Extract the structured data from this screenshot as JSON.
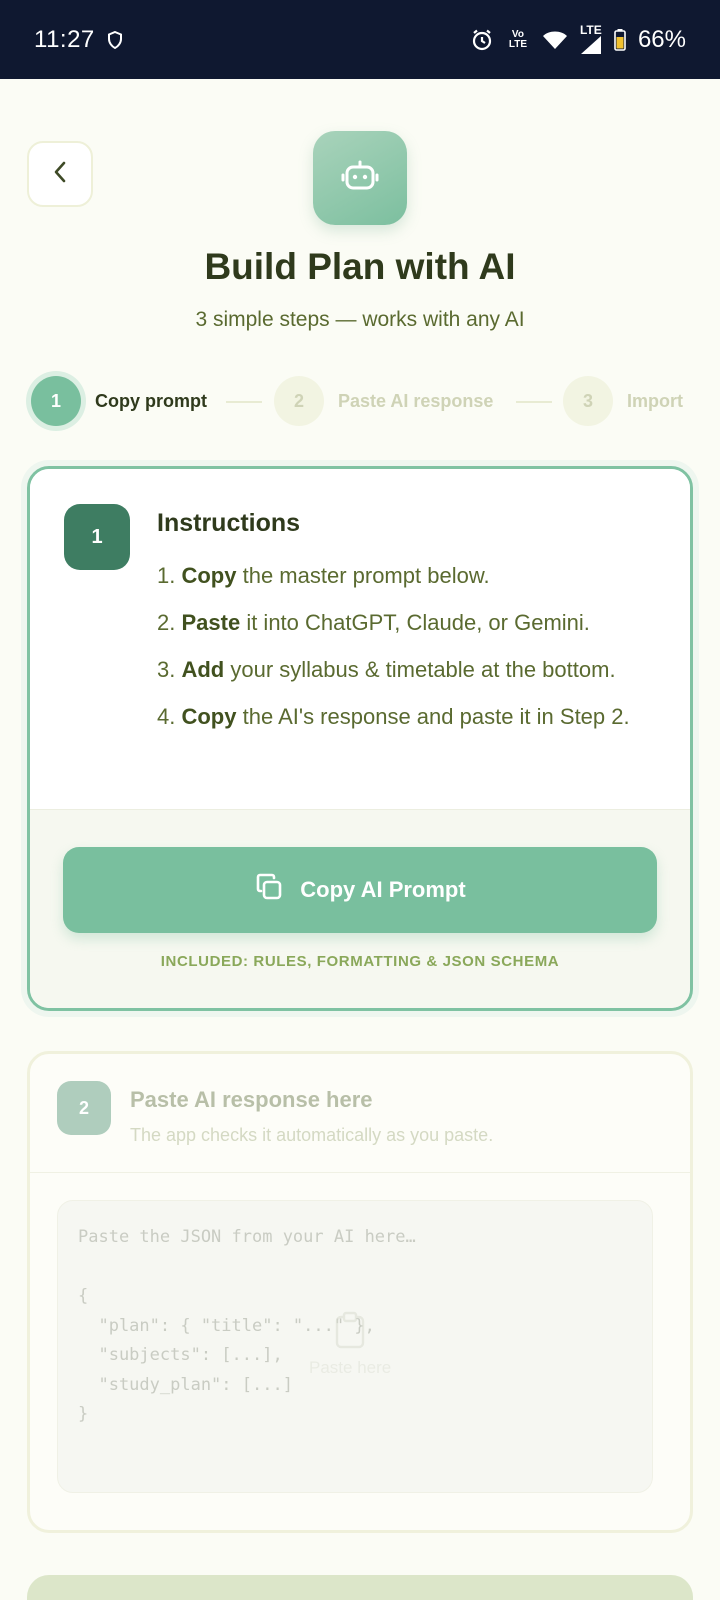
{
  "status_bar": {
    "time": "11:27",
    "volte_label": "Vo LTE",
    "lte_label": "LTE",
    "battery": "66%"
  },
  "header": {
    "title": "Build Plan with AI",
    "subtitle": "3 simple steps — works with any AI"
  },
  "stepper": {
    "steps": [
      {
        "number": "1",
        "label": "Copy prompt"
      },
      {
        "number": "2",
        "label": "Paste AI response"
      },
      {
        "number": "3",
        "label": "Import"
      }
    ]
  },
  "card_instructions": {
    "number": "1",
    "title": "Instructions",
    "items": [
      {
        "num": "1.",
        "bold": "Copy",
        "rest": " the master prompt below."
      },
      {
        "num": "2.",
        "bold": "Paste",
        "rest": " it into ChatGPT, Claude, or Gemini."
      },
      {
        "num": "3.",
        "bold": "Add",
        "rest": " your syllabus & timetable at the bottom."
      },
      {
        "num": "4.",
        "bold": "Copy",
        "rest": " the AI's response and paste it in Step 2."
      }
    ],
    "copy_button": "Copy AI Prompt",
    "included_note": "INCLUDED: RULES, FORMATTING & JSON SCHEMA"
  },
  "card_paste": {
    "number": "2",
    "title": "Paste AI response here",
    "subtitle": "The app checks it automatically as you paste.",
    "placeholder": "Paste the JSON from your AI here…\n\n{\n  \"plan\": { \"title\": \"...\" },\n  \"subjects\": [...],\n  \"study_plan\": [...]\n}",
    "hint": "Paste here"
  },
  "colors": {
    "accent": "#79bf9e",
    "accent_dark": "#3e7d62",
    "text_dark": "#2f3a1c",
    "text_olive": "#5a6a30",
    "background": "#fbfcf5"
  }
}
